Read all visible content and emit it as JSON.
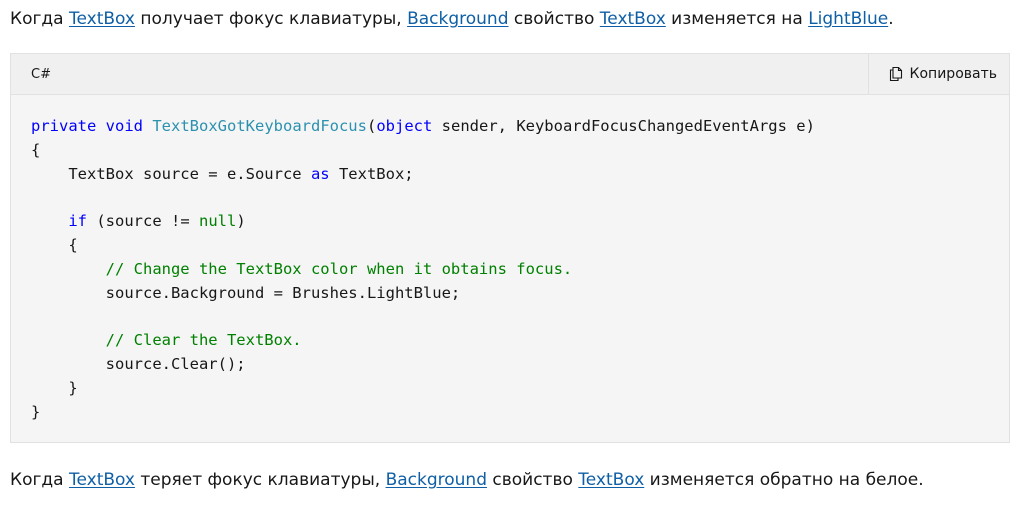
{
  "intro": {
    "w1": "Когда ",
    "l1": "TextBox",
    "w2": " получает фокус клавиатуры, ",
    "l2": "Background",
    "w3": " свойство ",
    "l3": "TextBox",
    "w4": " изменяется на ",
    "l4": "LightBlue",
    "w5": "."
  },
  "code": {
    "language": "C#",
    "copy_label": "Копировать",
    "lines": [
      [
        {
          "t": "private",
          "c": "kw"
        },
        {
          "t": " "
        },
        {
          "t": "void",
          "c": "kw"
        },
        {
          "t": " "
        },
        {
          "t": "TextBoxGotKeyboardFocus",
          "c": "type"
        },
        {
          "t": "("
        },
        {
          "t": "object",
          "c": "kw"
        },
        {
          "t": " sender, KeyboardFocusChangedEventArgs e)"
        }
      ],
      [
        {
          "t": "{"
        }
      ],
      [
        {
          "t": "    TextBox source = e.Source "
        },
        {
          "t": "as",
          "c": "kw"
        },
        {
          "t": " TextBox;"
        }
      ],
      [
        {
          "t": ""
        }
      ],
      [
        {
          "t": "    "
        },
        {
          "t": "if",
          "c": "kw"
        },
        {
          "t": " (source != "
        },
        {
          "t": "null",
          "c": "nl"
        },
        {
          "t": ")"
        }
      ],
      [
        {
          "t": "    {"
        }
      ],
      [
        {
          "t": "        "
        },
        {
          "t": "// Change the TextBox color when it obtains focus.",
          "c": "cm"
        }
      ],
      [
        {
          "t": "        source.Background = Brushes.LightBlue;"
        }
      ],
      [
        {
          "t": ""
        }
      ],
      [
        {
          "t": "        "
        },
        {
          "t": "// Clear the TextBox.",
          "c": "cm"
        }
      ],
      [
        {
          "t": "        source.Clear();"
        }
      ],
      [
        {
          "t": "    }"
        }
      ],
      [
        {
          "t": "}"
        }
      ]
    ]
  },
  "outro": {
    "w1": "Когда ",
    "l1": "TextBox",
    "w2": " теряет фокус клавиатуры, ",
    "l2": "Background",
    "w3": " свойство ",
    "l3": "TextBox",
    "w4": " изменяется обратно на белое."
  },
  "colors": {
    "link": "#0f5fa6",
    "keyword": "#0101fd",
    "method": "#2b91af",
    "comment": "#008000",
    "code_background": "#f5f5f5"
  },
  "icons": {
    "copy": "copy-icon"
  }
}
